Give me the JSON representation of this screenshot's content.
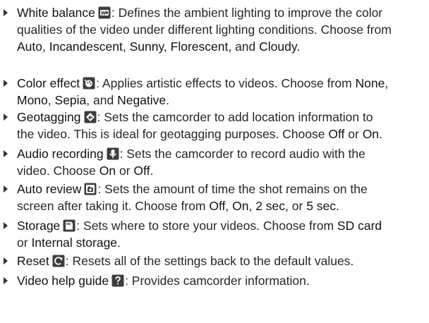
{
  "items": [
    {
      "icon": "white-balance-icon",
      "line1_pre": "White balance",
      "line1_post": ": Defines the ambient lighting to improve the color",
      "line2": "qualities of the video under different lighting conditions. Choose from",
      "opt1": "Auto",
      "sep1": ", ",
      "opt2": "Incandescent",
      "sep2": ", ",
      "opt3": "Sunny",
      "sep3": ", ",
      "opt4": "Florescent",
      "sep4": ", and ",
      "opt5": "Cloudy",
      "end": "."
    },
    {
      "icon": "color-effect-icon",
      "title": "Color effect",
      "desc": ": Applies artistic effects to videos. Choose from ",
      "opt1": "None",
      "sep1": ",",
      "opt2": "Mono",
      "sep2": ", ",
      "opt3": "Sepia",
      "sep3": ", and ",
      "opt4": "Negative",
      "end": "."
    },
    {
      "icon": "geotagging-icon",
      "title": "Geotagging",
      "desc": ": Sets the camcorder to add location information to",
      "line2": "the video. This is ideal for geotagging purposes. Choose ",
      "opt1": "Off",
      "sep1": " or ",
      "opt2": "On",
      "end": "."
    },
    {
      "icon": "microphone-icon",
      "title": "Audio recording",
      "desc": ": Sets the camcorder to record audio with the",
      "line2": "video. Choose ",
      "opt1": "On",
      "sep1": " or ",
      "opt2": "Off",
      "end": "."
    },
    {
      "icon": "auto-review-icon",
      "title": "Auto review",
      "desc": ": Sets the amount of time the shot remains on the",
      "line2": "screen after taking it. Choose from ",
      "opt1": "Off",
      "sep1": ", ",
      "opt2": "On",
      "sep2": ", ",
      "opt3": "2 sec",
      "sep3": ", or ",
      "opt4": "5 sec",
      "end": "."
    },
    {
      "icon": "storage-icon",
      "title": "Storage",
      "desc": ": Sets where to store your videos. Choose from ",
      "opt1": "SD card",
      "line2_pre": "or ",
      "opt2": "Internal storage",
      "end": "."
    },
    {
      "icon": "reset-icon",
      "title": "Reset",
      "desc": ": Resets all of the settings back to the default values."
    },
    {
      "icon": "help-icon",
      "title": "Video help guide",
      "desc": ": Provides camcorder information."
    }
  ]
}
